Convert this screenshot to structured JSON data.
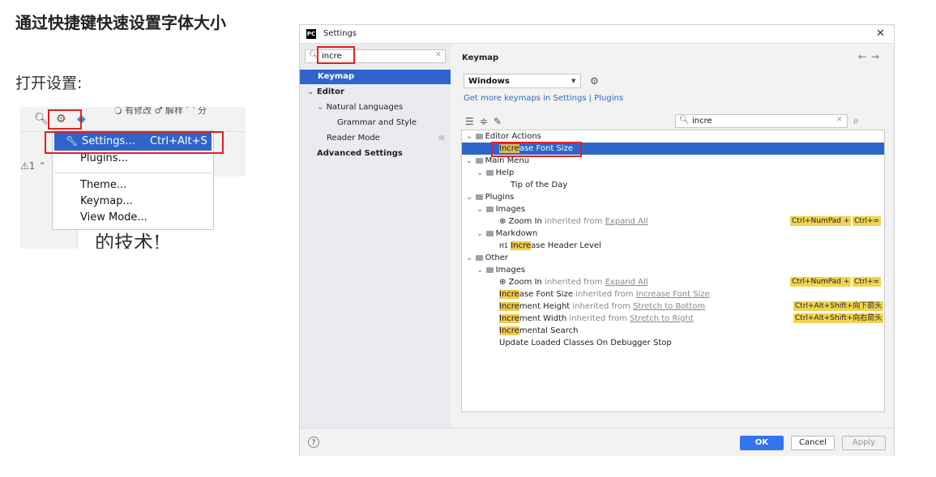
{
  "article": {
    "title": "通过快捷键快速设置字体大小",
    "open_settings": "打开设置:"
  },
  "ide": {
    "top_text": "🔾 有修改  ♂ 解样  ⌒ 分",
    "warning": "⚠1 ⌃",
    "big_text": "的技术!",
    "menu": {
      "settings_label": "Settings...",
      "settings_shortcut": "Ctrl+Alt+S",
      "plugins": "Plugins...",
      "theme": "Theme...",
      "keymap": "Keymap...",
      "view_mode": "View Mode..."
    }
  },
  "dialog": {
    "title": "Settings",
    "logo": "PC",
    "left_search": "incre",
    "left_tree": {
      "keymap": "Keymap",
      "editor": "Editor",
      "natural_languages": "Natural Languages",
      "grammar": "Grammar and Style",
      "reader_mode": "Reader Mode",
      "advanced": "Advanced Settings"
    },
    "right": {
      "title": "Keymap",
      "scheme": "Windows",
      "more_link": "Get more keymaps in Settings | Plugins",
      "search": "incre"
    },
    "tree": {
      "editor_actions": "Editor Actions",
      "inc_font_hl": "Incre",
      "inc_font_rest": "ase Font Size",
      "main_menu": "Main Menu",
      "help": "Help",
      "tip": "Tip of the Day",
      "plugins": "Plugins",
      "images": "Images",
      "zoom_in": "Zoom In",
      "inherited_from": "inherited from",
      "expand_all": "Expand All",
      "kb_numpad": "Ctrl+NumPad +",
      "kb_eq": "Ctrl+=",
      "markdown": "Markdown",
      "h1": "H1",
      "inc_hdr_hl": "Incre",
      "inc_hdr_rest": "ase Header Level",
      "other": "Other",
      "images2": "Images",
      "inc_font2_rest": "ase Font Size",
      "inc_font_link": "Increase Font Size",
      "incr_hl": "Incre",
      "incr_height_rest": "ment Height",
      "stretch_bottom": "Stretch to Bottom",
      "kb_down": "Ctrl+Alt+Shift+向下箭头",
      "incr_width_rest": "ment Width",
      "stretch_right": "Stretch to Right",
      "kb_right": "Ctrl+Alt+Shift+向右箭头",
      "incr_search_rest": "mental Search",
      "update_loaded": "Update Loaded Classes On Debugger Stop"
    },
    "buttons": {
      "help": "?",
      "ok": "OK",
      "cancel": "Cancel",
      "apply": "Apply"
    }
  }
}
